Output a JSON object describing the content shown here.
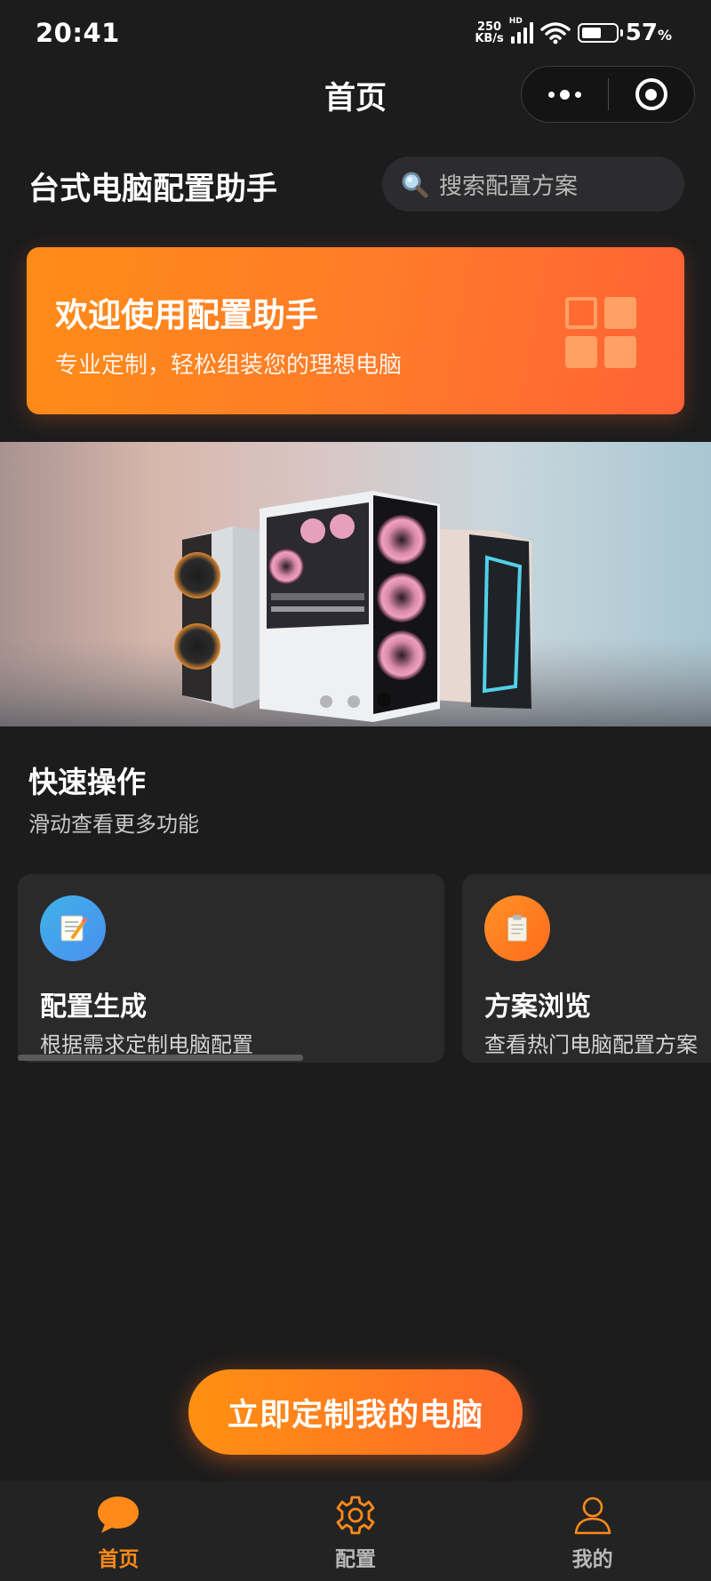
{
  "status_bar": {
    "time": "20:41",
    "net_speed_value": "250",
    "net_speed_unit": "KB/s",
    "signal_label": "HD",
    "battery_percent": "57",
    "battery_unit": "%",
    "battery_level": 0.57
  },
  "nav": {
    "title": "首页"
  },
  "header": {
    "app_title": "台式电脑配置助手",
    "search_placeholder": "搜索配置方案"
  },
  "banner": {
    "title": "欢迎使用配置助手",
    "subtitle": "专业定制，轻松组装您的理想电脑"
  },
  "quick_actions": {
    "title": "快速操作",
    "subtitle": "滑动查看更多功能",
    "cards": [
      {
        "title": "配置生成",
        "description": "根据需求定制电脑配置",
        "icon": "memo-icon"
      },
      {
        "title": "方案浏览",
        "description": "查看热门电脑配置方案",
        "icon": "clipboard-icon"
      }
    ],
    "scroll_progress": 0.6
  },
  "cta": {
    "label": "立即定制我的电脑"
  },
  "tab_bar": {
    "items": [
      {
        "label": "首页",
        "icon": "chat-bubble-icon",
        "active": true
      },
      {
        "label": "配置",
        "icon": "gear-icon",
        "active": false
      },
      {
        "label": "我的",
        "icon": "user-icon",
        "active": false
      }
    ]
  },
  "colors": {
    "accent": "#ff8a1a",
    "background": "#1c1c1d",
    "card": "#2a2a2b"
  }
}
